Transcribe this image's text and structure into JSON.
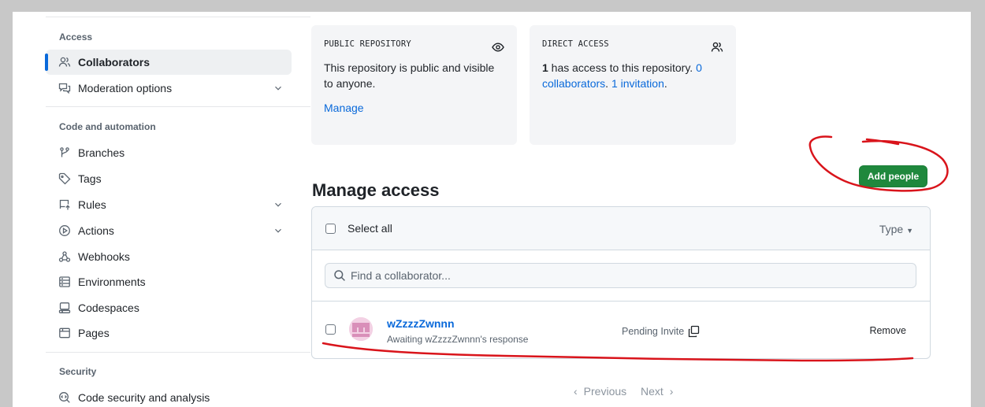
{
  "sidebar": {
    "sections": [
      {
        "title": "Access"
      },
      {
        "title": "Code and automation"
      },
      {
        "title": "Security"
      }
    ],
    "items": [
      {
        "label": "Collaborators",
        "icon": "people-icon",
        "selected": true
      },
      {
        "label": "Moderation options",
        "icon": "comment-discussion-icon",
        "expandable": true
      },
      {
        "label": "Branches",
        "icon": "git-branch-icon"
      },
      {
        "label": "Tags",
        "icon": "tag-icon"
      },
      {
        "label": "Rules",
        "icon": "repo-push-icon",
        "expandable": true
      },
      {
        "label": "Actions",
        "icon": "play-icon",
        "expandable": true
      },
      {
        "label": "Webhooks",
        "icon": "webhook-icon"
      },
      {
        "label": "Environments",
        "icon": "server-icon"
      },
      {
        "label": "Codespaces",
        "icon": "codespaces-icon"
      },
      {
        "label": "Pages",
        "icon": "browser-icon"
      },
      {
        "label": "Code security and analysis",
        "icon": "codescan-icon"
      }
    ]
  },
  "cards": {
    "public": {
      "label": "PUBLIC REPOSITORY",
      "text": "This repository is public and visible to anyone.",
      "manage": "Manage"
    },
    "direct": {
      "label": "DIRECT ACCESS",
      "count": "1",
      "text_mid": " has access to this repository. ",
      "collaborators_link": "0 collaborators",
      "sep": ". ",
      "invitations_link": "1 invitation",
      "end": "."
    }
  },
  "main": {
    "heading": "Manage access",
    "add_button": "Add people"
  },
  "table": {
    "select_all": "Select all",
    "type_filter": "Type",
    "search_placeholder": "Find a collaborator...",
    "rows": [
      {
        "name": "wZzzzZwnnn",
        "sub": "Awaiting wZzzzZwnnn's response",
        "status": "Pending Invite",
        "action": "Remove"
      }
    ]
  },
  "pagination": {
    "previous": "Previous",
    "next": "Next"
  },
  "colors": {
    "accent": "#0969da",
    "primary_button": "#1f883d",
    "annotation": "#d9141b"
  }
}
